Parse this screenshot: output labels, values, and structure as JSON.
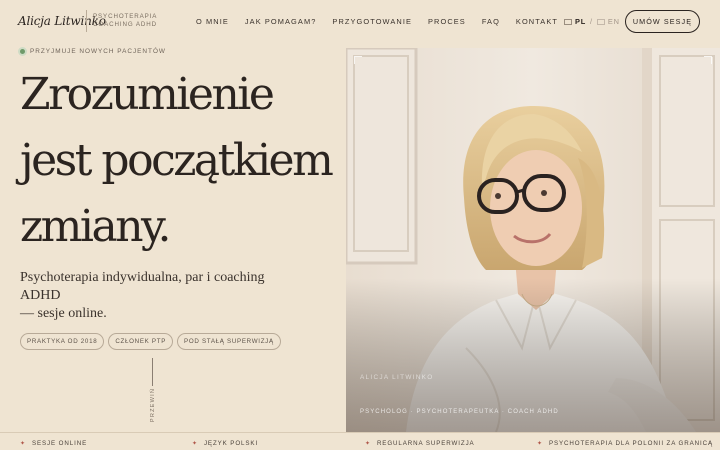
{
  "header": {
    "logo_signature": "Alicja Litwinko",
    "logo_subtitle_line1": "PSYCHOTERAPIA",
    "logo_subtitle_line2": "COACHING ADHD",
    "nav": [
      "O MNIE",
      "JAK POMAGAM?",
      "PRZYGOTOWANIE",
      "PROCES",
      "FAQ",
      "KONTAKT"
    ],
    "lang_pl": "PL",
    "lang_sep": "/",
    "lang_en": "EN",
    "cta": "UMÓW SESJĘ"
  },
  "hero": {
    "status": "PRZYJMUJE NOWYCH PACJENTÓW",
    "headline": [
      "Zrozumienie",
      "jest początkiem",
      "zmiany."
    ],
    "subtitle_line1": "Psychoterapia indywidualna, par i coaching ADHD",
    "subtitle_line2": "— sesje online.",
    "badges": [
      "PRAKTYKA OD 2018",
      "CZŁONEK PTP",
      "POD STAŁĄ SUPERWIZJĄ"
    ],
    "scroll_label": "PRZEWIŃ"
  },
  "photo": {
    "caption_name": "ALICJA LITWINKO",
    "caption_role": "PSYCHOLOG · PSYCHOTERAPEUTKA · COACH ADHD"
  },
  "features": [
    "SESJE ONLINE",
    "JĘZYK POLSKI",
    "REGULARNA SUPERWIZJA",
    "PSYCHOTERAPIA DLA POLONII ZA GRANICĄ"
  ],
  "colors": {
    "background": "#efe4d2",
    "text": "#2b2420",
    "accent_star": "#b1584b",
    "status_dot": "#6f9a6a"
  }
}
